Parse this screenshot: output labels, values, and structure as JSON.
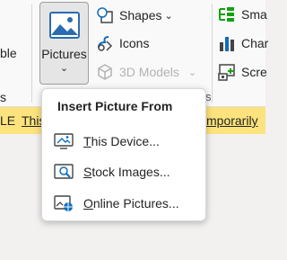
{
  "ribbon": {
    "left_fragment": "ble",
    "left_fragment2": "s",
    "pictures_label": "Pictures",
    "pictures_chevron": "⌄",
    "shapes_label": "Shapes",
    "shapes_chevron": "⌄",
    "icons_label": "Icons",
    "models_label": "3D Models",
    "models_chevron": "⌄",
    "illustrations_fragment": "s",
    "smart_label": "Sma",
    "chart_label": "Char",
    "screen_label": "Scre"
  },
  "banner": {
    "left": "LE",
    "link": "This",
    "right": "mporarily"
  },
  "menu": {
    "title": "Insert Picture From",
    "items": [
      {
        "label": "This Device...",
        "icon": "device-picture-icon"
      },
      {
        "label": "Stock Images...",
        "icon": "stock-images-icon"
      },
      {
        "label": "Online Pictures...",
        "icon": "online-pictures-icon"
      }
    ]
  },
  "colors": {
    "accent": "#0f6cbd",
    "banner": "#fce37d",
    "green": "#13a10e"
  }
}
